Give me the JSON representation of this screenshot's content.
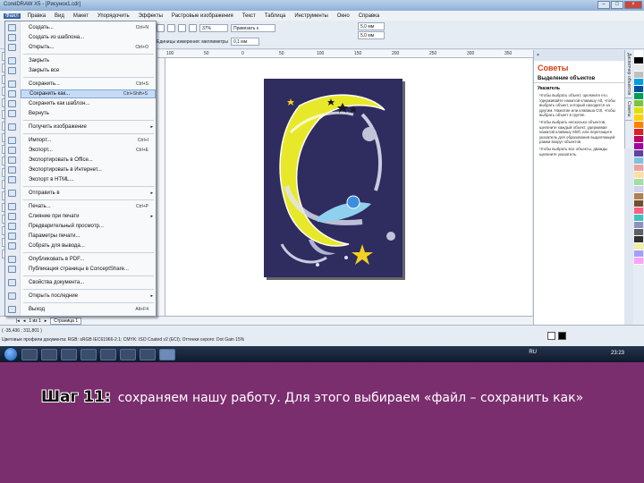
{
  "window": {
    "title": "CorelDRAW X5 - [Рисунок1.cdr]",
    "controls": [
      "–",
      "□",
      "×"
    ]
  },
  "menubar": {
    "items": [
      "Файл",
      "Правка",
      "Вид",
      "Макет",
      "Упорядочить",
      "Эффекты",
      "Растровые изображения",
      "Текст",
      "Таблица",
      "Инструменты",
      "Окно",
      "Справка"
    ],
    "active_index": 0
  },
  "toolbar": {
    "zoom": "37%",
    "snap_label": "Привязать к",
    "units_label": "Единицы измерения: миллиметры",
    "nudge": "0,1 мм",
    "dup_x": "5,0 мм",
    "dup_y": "5,0 мм"
  },
  "file_menu": {
    "items": [
      {
        "label": "Создать...",
        "shortcut": "Ctrl+N"
      },
      {
        "label": "Создать из шаблона...",
        "shortcut": ""
      },
      {
        "label": "Открыть...",
        "shortcut": "Ctrl+O"
      },
      {
        "label": "Закрыть",
        "shortcut": ""
      },
      {
        "label": "Закрыть все",
        "shortcut": ""
      },
      {
        "label": "Сохранить...",
        "shortcut": "Ctrl+S"
      },
      {
        "label": "Сохранить как...",
        "shortcut": "Ctrl+Shift+S",
        "highlighted": true
      },
      {
        "label": "Сохранить как шаблон...",
        "shortcut": ""
      },
      {
        "label": "Вернуть",
        "shortcut": ""
      },
      {
        "label": "Получить изображение",
        "shortcut": "",
        "submenu": true
      },
      {
        "label": "Импорт...",
        "shortcut": "Ctrl+I"
      },
      {
        "label": "Экспорт...",
        "shortcut": "Ctrl+E"
      },
      {
        "label": "Экспортировать в Office...",
        "shortcut": ""
      },
      {
        "label": "Экспортировать в Интернет...",
        "shortcut": ""
      },
      {
        "label": "Экспорт в HTML...",
        "shortcut": ""
      },
      {
        "label": "Отправить в",
        "shortcut": "",
        "submenu": true
      },
      {
        "label": "Печать...",
        "shortcut": "Ctrl+P"
      },
      {
        "label": "Слияние при печати",
        "shortcut": "",
        "submenu": true
      },
      {
        "label": "Предварительный просмотр...",
        "shortcut": ""
      },
      {
        "label": "Параметры печати...",
        "shortcut": ""
      },
      {
        "label": "Собрать для вывода...",
        "shortcut": ""
      },
      {
        "label": "Опубликовать в PDF...",
        "shortcut": ""
      },
      {
        "label": "Публикация страницы в ConceptShare...",
        "shortcut": ""
      },
      {
        "label": "Свойства документа...",
        "shortcut": ""
      },
      {
        "label": "Открыть последние",
        "shortcut": "",
        "submenu": true
      },
      {
        "label": "Выход",
        "shortcut": "Alt+F4"
      }
    ]
  },
  "ruler": {
    "ticks": [
      "100",
      "50",
      "0",
      "50",
      "100",
      "150",
      "200",
      "250",
      "300",
      "350"
    ]
  },
  "docker": {
    "title": "Советы",
    "subtitle": "Выделение объектов",
    "section": "Указатель",
    "bullets": [
      "Чтобы выбрать объект, щелкните его. Удерживайте нажатой клавишу Alt, чтобы выбрать объект, который находится за другим. Нажатие или клавиша Ctrl, чтобы выбрать объект в группе.",
      "Чтобы выбрать несколько объектов, щелкните каждый объект, удерживая нажатой клавишу Shift, или перетащите указатель для образования выделяющей рамки вокруг объектов",
      "Чтобы выбрать все объекты, дважды щелкните указатель."
    ],
    "side_tabs": [
      "Диспетчер объектов",
      "Советы"
    ]
  },
  "pagebar": {
    "page_counter": "1 из 1",
    "page_tab": "Страница 1"
  },
  "statusbar": {
    "line1": "( -35,436 ; 311,801 )",
    "line2": "Цветовые профили документа: RGB: sRGB IEC61966-2.1; CMYK: ISO Coated v2 (ECI); Оттенки серого: Dot Gain 15%"
  },
  "taskbar": {
    "lang": "RU",
    "clock": "23:23"
  },
  "caption": {
    "step": "Шаг 11:",
    "text": "сохраняем нашу работу. Для этого выбираем «файл – сохранить как»"
  },
  "colors": {
    "slide_bg": "#7a2e6e",
    "artboard_bg": "#2f2c5f",
    "moon_yellow": "#e8e82a",
    "docker_title": "#d84010"
  },
  "palette": [
    "#ffffff",
    "#000000",
    "#e8e8e8",
    "#c0c0c0",
    "#00a0e0",
    "#0050a0",
    "#00a050",
    "#80c040",
    "#e0e000",
    "#ffd000",
    "#ff8000",
    "#e02020",
    "#c00060",
    "#a000a0",
    "#6040a0",
    "#80c0e0",
    "#f0a0a0",
    "#ffe0a0",
    "#a0e0a0",
    "#d0d0f0",
    "#b08050",
    "#705030",
    "#ff6080",
    "#40c0c0",
    "#9090c0",
    "#606060",
    "#303030",
    "#f0f0a0",
    "#a0a0ff",
    "#ffa0ff"
  ]
}
